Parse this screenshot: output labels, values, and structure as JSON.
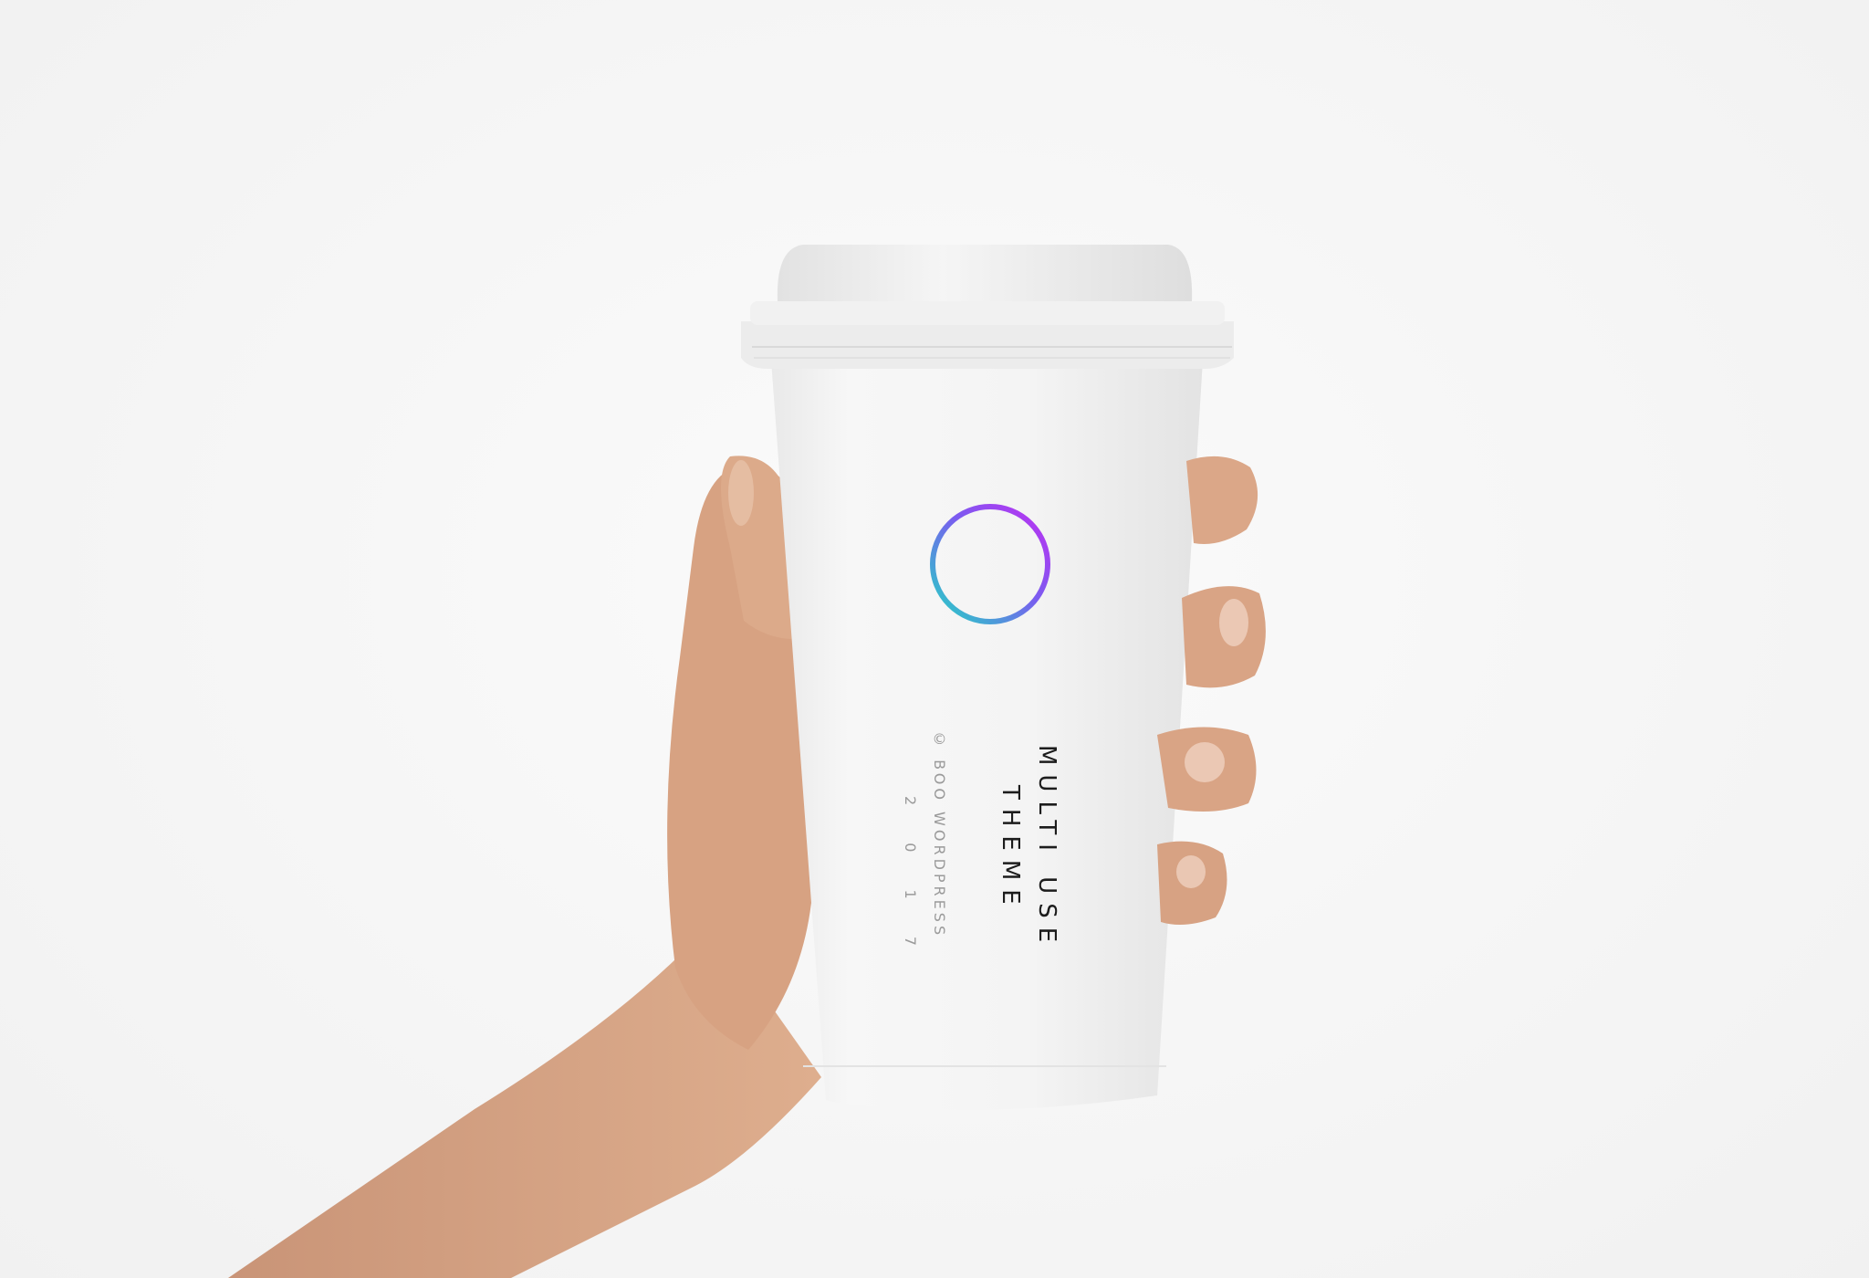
{
  "product": {
    "title_line_1": "MULTI USE",
    "title_line_2": "THEME",
    "credit": "© BOO WORDPRESS",
    "year": "2 0 1 7"
  },
  "colors": {
    "background": "#f5f5f5",
    "cup": "#f2f2f2",
    "lid": "#ebebeb",
    "skin": "#d9a888",
    "logo_gradient_start": "#b33cf0",
    "logo_gradient_end": "#2fd3c8"
  },
  "icons": {
    "logo": "gradient-ring-logo"
  }
}
